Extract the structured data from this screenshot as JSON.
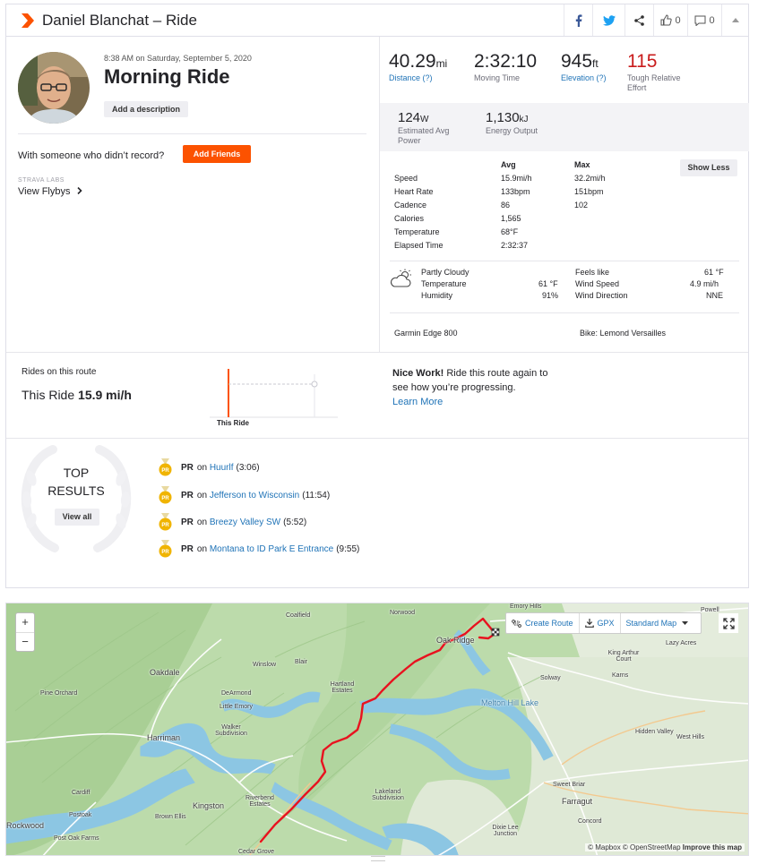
{
  "header": {
    "title": "Daniel Blanchat – Ride",
    "kudos_count": "0",
    "comment_count": "0"
  },
  "activity": {
    "date": "8:38 AM on Saturday, September 5, 2020",
    "name": "Morning Ride",
    "add_description": "Add a description",
    "with_someone": "With someone who didn’t record?",
    "add_friends": "Add Friends",
    "labs_label": "STRAVA LABS",
    "view_flybys": "View Flybys"
  },
  "stats": {
    "distance": {
      "value": "40.29",
      "unit": "mi",
      "label": "Distance (?)"
    },
    "moving_time": {
      "value": "2:32:10",
      "label": "Moving Time"
    },
    "elevation": {
      "value": "945",
      "unit": "ft",
      "label": "Elevation (?)"
    },
    "relative_effort": {
      "value": "115",
      "label_line1": "Tough Relative",
      "label_line2": "Effort"
    },
    "power": {
      "value": "124",
      "unit": "W",
      "label_line1": "Estimated Avg",
      "label_line2": "Power"
    },
    "energy": {
      "value": "1,130",
      "unit": "kJ",
      "label": "Energy Output"
    }
  },
  "more_stats": {
    "col_avg": "Avg",
    "col_max": "Max",
    "show_less": "Show Less",
    "rows": [
      {
        "label": "Speed",
        "avg": "15.9mi/h",
        "max": "32.2mi/h"
      },
      {
        "label": "Heart Rate",
        "avg": "133bpm",
        "max": "151bpm"
      },
      {
        "label": "Cadence",
        "avg": "86",
        "max": "102"
      },
      {
        "label": "Calories",
        "avg": "1,565",
        "max": ""
      },
      {
        "label": "Temperature",
        "avg": "68°F",
        "max": ""
      },
      {
        "label": "Elapsed Time",
        "avg": "2:32:37",
        "max": ""
      }
    ]
  },
  "weather": {
    "condition": "Partly Cloudy",
    "temperature_label": "Temperature",
    "temperature": "61 °F",
    "humidity_label": "Humidity",
    "humidity": "91%",
    "feels_like_label": "Feels like",
    "feels_like": "61 °F",
    "wind_speed_label": "Wind Speed",
    "wind_speed": "4.9 mi/h",
    "wind_direction_label": "Wind Direction",
    "wind_direction": "NNE",
    "icon": "partly-cloudy-icon"
  },
  "device": {
    "device_name": "Garmin Edge 800",
    "bike": "Bike: Lemond Versailles"
  },
  "route": {
    "label": "Rides on this route",
    "this_ride_prefix": "This Ride",
    "this_ride_speed": "15.9 mi/h",
    "chart_label": "This Ride",
    "nice_work_bold": "Nice Work!",
    "nice_work_text": " Ride this route again to see how you’re progressing.",
    "learn_more": "Learn More"
  },
  "top_results": {
    "title_line1": "TOP",
    "title_line2": "RESULTS",
    "view_all": "View all",
    "items": [
      {
        "badge": "PR",
        "on": "on",
        "segment": "Huurlf",
        "time": "(3:06)"
      },
      {
        "badge": "PR",
        "on": "on",
        "segment": "Jefferson to Wisconsin",
        "time": "(11:54)"
      },
      {
        "badge": "PR",
        "on": "on",
        "segment": "Breezy Valley SW",
        "time": "(5:52)"
      },
      {
        "badge": "PR",
        "on": "on",
        "segment": "Montana to ID Park E Entrance",
        "time": "(9:55)"
      }
    ]
  },
  "map": {
    "zoom_in": "+",
    "zoom_out": "−",
    "create_route": "Create Route",
    "gpx": "GPX",
    "map_style": "Standard Map",
    "attribution_prefix": "© Mapbox © OpenStreetMap ",
    "improve": "Improve this map",
    "labels": {
      "coalfield": "Coalfield",
      "norwood": "Norwood",
      "emory_hills": "Emory Hills",
      "powell": "Powell",
      "oak_ridge": "Oak Ridge",
      "lazy_acres": "Lazy Acres",
      "king_arthur_court": "King Arthur Court",
      "oakdale": "Oakdale",
      "winslow": "Winslow",
      "blair": "Blair",
      "karns": "Karns",
      "solway": "Solway",
      "pine_orchard": "Pine Orchard",
      "dearmond": "DeArmond",
      "hartland_estates": "Hartland Estates",
      "little_emory": "Little Emory",
      "melton_hill_lake": "Melton Hill Lake",
      "harriman": "Harriman",
      "walker_subdivision": "Walker Subdivision",
      "hidden_valley": "Hidden Valley",
      "west_hills": "West Hills",
      "cardiff": "Cardiff",
      "sweet_briar": "Sweet Briar",
      "lakeland_subdivision": "Lakeland Subdivision",
      "farragut": "Farragut",
      "kingston": "Kingston",
      "riverbend_estates": "Riverbend Estates",
      "postoak": "Postoak",
      "brown_ellis": "Brown Ellis",
      "concord": "Concord",
      "rockwood": "Rockwood",
      "post_oak_farms": "Post Oak Farms",
      "dixie_lee_junction": "Dixie Lee Junction",
      "cedar_grove": "Cedar Grove"
    }
  },
  "colors": {
    "brand": "#fc5200",
    "link": "#1f73b7",
    "relative_effort": "#c91c1c",
    "route_line": "#e8121f",
    "medal": "#f0b400"
  }
}
